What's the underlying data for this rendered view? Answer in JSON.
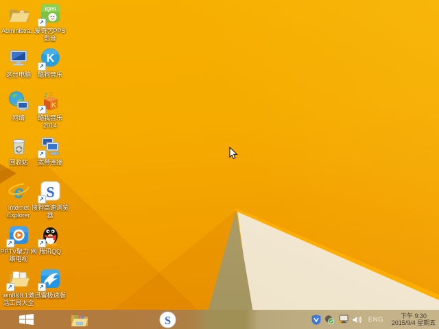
{
  "desktop_icons": [
    {
      "id": "user-folder-administrator",
      "label": "Administra...",
      "shortcut": false
    },
    {
      "id": "iqiyi-pps",
      "label": "爱奇艺PPS 影音",
      "shortcut": true
    },
    {
      "id": "this-pc",
      "label": "这台电脑",
      "shortcut": false
    },
    {
      "id": "kugou-music",
      "label": "酷狗音乐",
      "shortcut": true
    },
    {
      "id": "network",
      "label": "网络",
      "shortcut": false
    },
    {
      "id": "kuwo-music-2014",
      "label": "酷我音乐 2014",
      "shortcut": true
    },
    {
      "id": "recycle-bin",
      "label": "回收站",
      "shortcut": false
    },
    {
      "id": "broadband-connection",
      "label": "宽带连接",
      "shortcut": true
    },
    {
      "id": "internet-explorer",
      "label": "Internet Explorer",
      "shortcut": false
    },
    {
      "id": "sogou-browser",
      "label": "搜狗高速浏览器",
      "shortcut": true
    },
    {
      "id": "pptv",
      "label": "PPTV聚力 网络电视",
      "shortcut": true
    },
    {
      "id": "tencent-qq",
      "label": "腾讯QQ",
      "shortcut": true
    },
    {
      "id": "win8-activation-tools",
      "label": "win8&8.1激活工具大全",
      "shortcut": true
    },
    {
      "id": "thunder-xunlei",
      "label": "迅雷极速版",
      "shortcut": true
    }
  ],
  "taskbar": {
    "pinned": [
      {
        "id": "start-button"
      },
      {
        "id": "file-explorer"
      },
      {
        "id": "sogou-browser"
      }
    ],
    "tray": {
      "language": "ENG",
      "time": "下午 9:30",
      "date": "2015/9/4 星期五",
      "icons": [
        "security-shield",
        "antivirus-ok",
        "network-warning",
        "volume"
      ]
    }
  },
  "colors": {
    "wallpaper_orange": "#f5ab00",
    "wallpaper_cream": "#f1e8d2",
    "wallpaper_tan": "#b3a26e",
    "taskbar_left": "#b3793a",
    "taskbar_right": "#c7b48b",
    "label_text": "#ffffff",
    "clock_text": "#443f35"
  }
}
